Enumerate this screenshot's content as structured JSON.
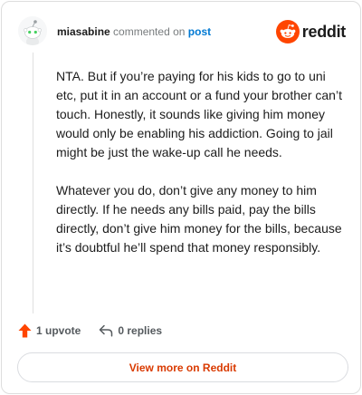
{
  "header": {
    "username": "miasabine",
    "commented_text": "commented on",
    "post_link": "post",
    "brand_word": "reddit"
  },
  "comment": {
    "paragraphs": [
      "NTA. But if you’re paying for his kids to go to uni etc, put it in an account or a fund your brother can’t touch. Honestly, it sounds like giving him money would only be enabling his addiction. Going to jail might be just the wake-up call he needs.",
      "Whatever you do, don’t give any money to him directly. If he needs any bills paid, pay the bills directly, don’t give him money for the bills, because it’s doubtful he’ll spend that money responsibly."
    ]
  },
  "actions": {
    "upvote_label": "1 upvote",
    "replies_label": "0 replies"
  },
  "footer": {
    "view_more_label": "View more on Reddit"
  },
  "colors": {
    "brand": "#ff4500",
    "link": "#0079d3",
    "view_more": "#d93a00",
    "muted": "#787c7e"
  },
  "icons": {
    "avatar": "snoo-avatar-icon",
    "brand": "reddit-logo-icon",
    "upvote": "upvote-arrow-icon",
    "reply": "reply-arrow-icon"
  }
}
